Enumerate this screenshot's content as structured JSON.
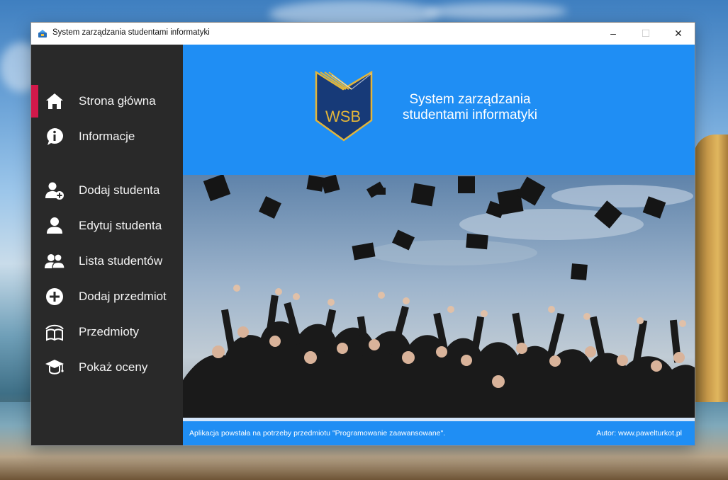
{
  "window": {
    "title": "System zarządzania studentami informatyki",
    "controls": {
      "minimize": "–",
      "maximize": "☐",
      "close": "✕"
    }
  },
  "sidebar": {
    "items": [
      {
        "label": "Strona główna",
        "icon": "home-icon",
        "active": true
      },
      {
        "label": "Informacje",
        "icon": "info-bubble-icon"
      },
      {
        "label": "Dodaj studenta",
        "icon": "add-user-icon"
      },
      {
        "label": "Edytuj studenta",
        "icon": "user-icon"
      },
      {
        "label": "Lista studentów",
        "icon": "users-icon"
      },
      {
        "label": "Dodaj przedmiot",
        "icon": "plus-circle-icon"
      },
      {
        "label": "Przedmioty",
        "icon": "book-icon"
      },
      {
        "label": "Pokaż oceny",
        "icon": "graduation-cap-icon"
      }
    ]
  },
  "header": {
    "logo_text": "WSB",
    "app_name_line1": "System zarządzania",
    "app_name_line2": "studentami informatyki"
  },
  "footer": {
    "left": "Aplikacja powstała na potrzeby przedmiotu \"Programowanie zaawansowane\".",
    "right": "Autor: www.pawelturkot.pl"
  },
  "colors": {
    "accent": "#1f8ef4",
    "sidebar_bg": "#292929",
    "active_marker": "#d3184a",
    "logo_navy": "#173a78",
    "logo_gold": "#e2b53a"
  }
}
